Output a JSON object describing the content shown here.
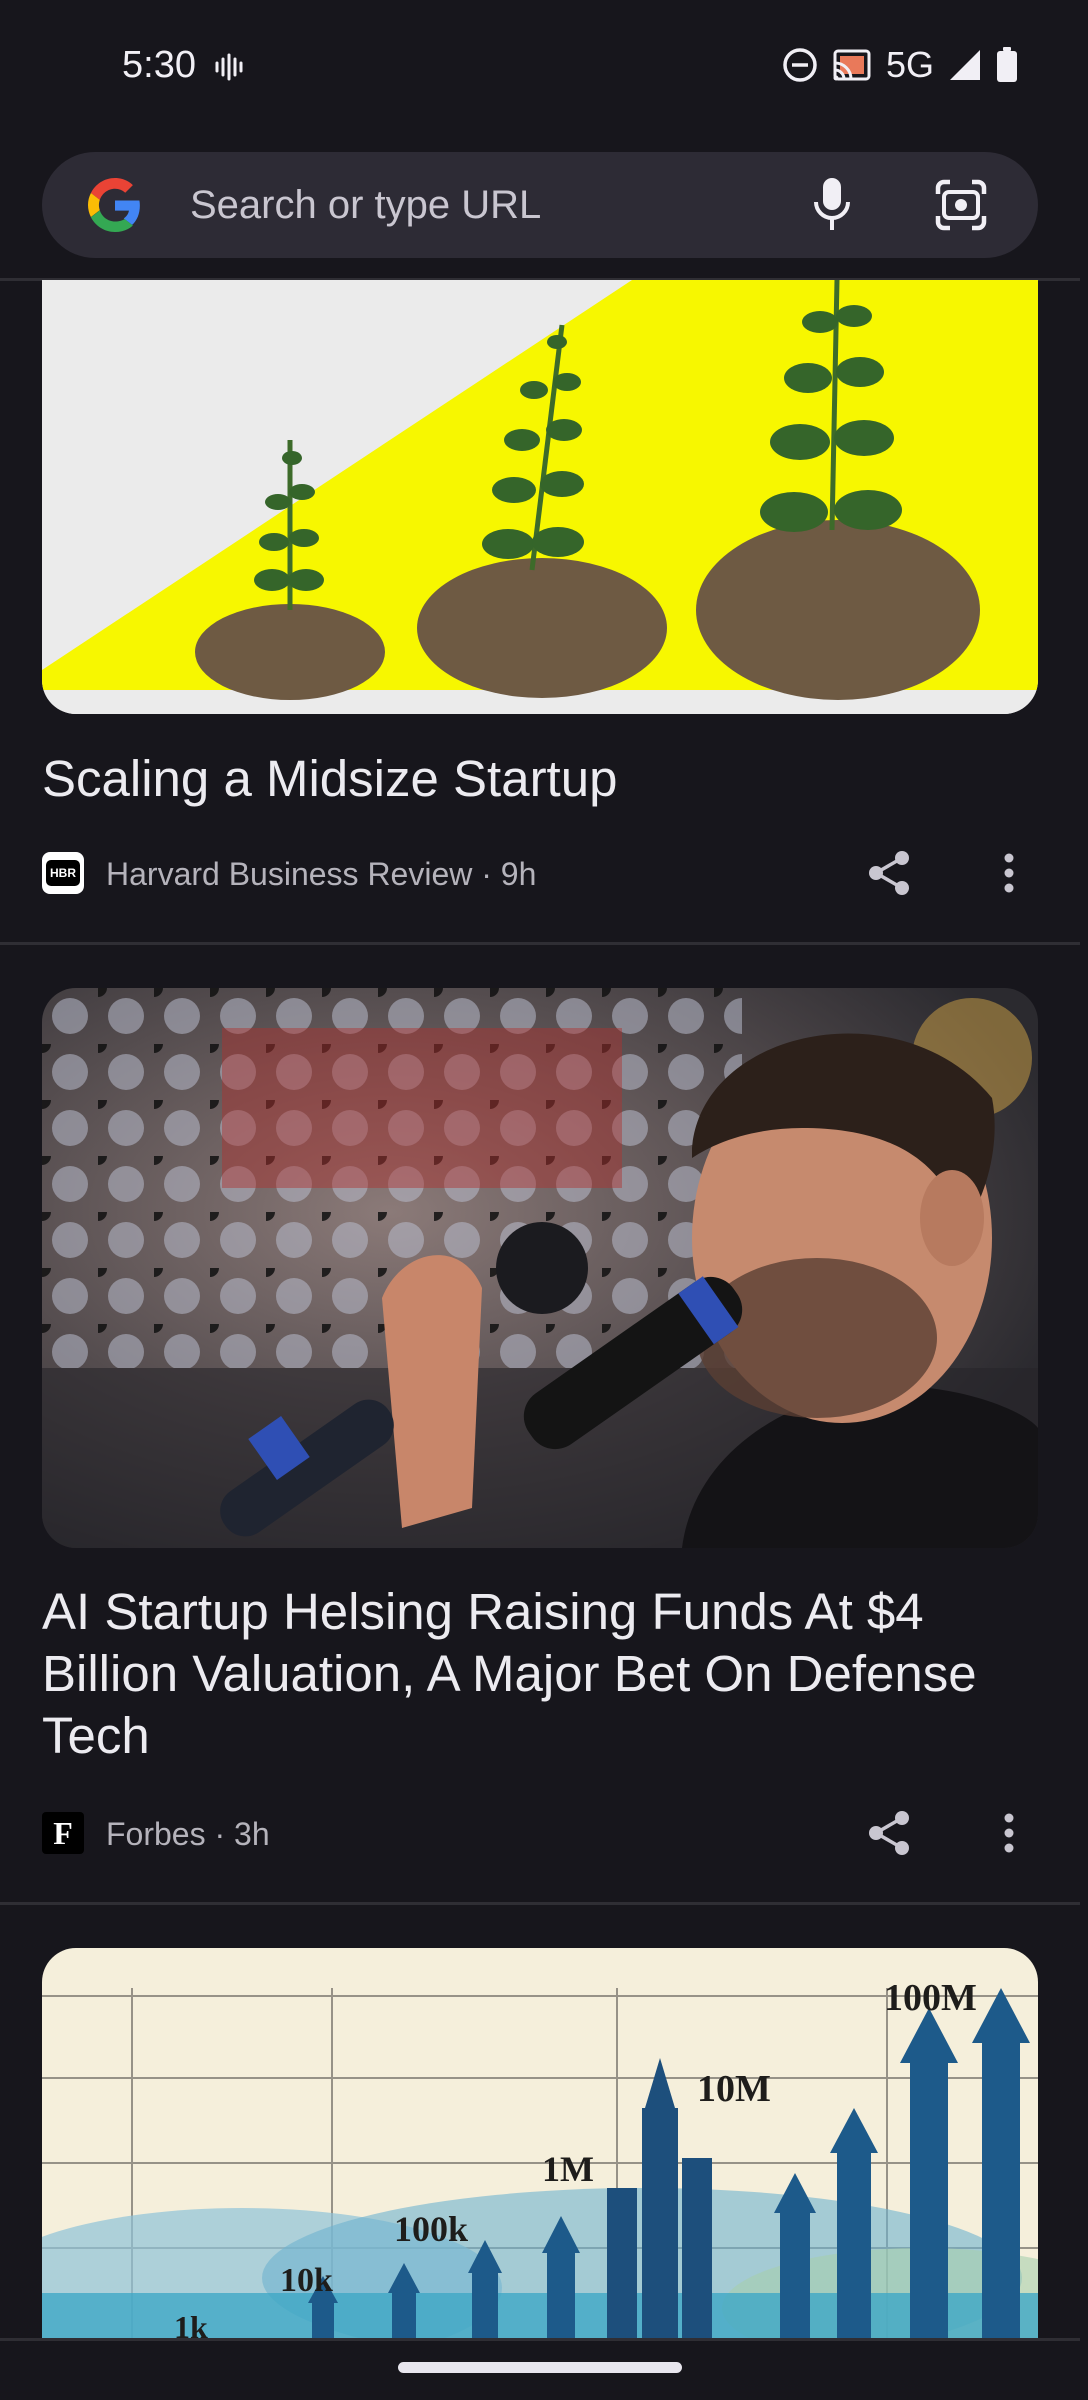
{
  "status_bar": {
    "time": "5:30",
    "network": "5G",
    "icons": [
      "vibrate-icon",
      "do-not-disturb-icon",
      "cast-icon",
      "signal-icon",
      "battery-icon"
    ]
  },
  "search": {
    "placeholder": "Search or type URL",
    "icons": [
      "google-logo",
      "mic-icon",
      "lens-icon"
    ]
  },
  "articles": [
    {
      "title": "Scaling a Midsize Startup",
      "source": "Harvard Business Review · 9h",
      "source_logo": "HBR",
      "image": "seedlings-growing-illustration"
    },
    {
      "title": "AI Startup Helsing Raising Funds At $4 Billion Valuation, A Major Bet On Defense Tech",
      "source": "Forbes · 3h",
      "source_logo": "F",
      "image": "man-speaking-into-microphone"
    },
    {
      "title": "",
      "source": "",
      "image": "growth-chart-illustration",
      "image_labels": [
        "1k",
        "10k",
        "100k",
        "1M",
        "10M",
        "100M"
      ]
    }
  ],
  "colors": {
    "background": "#17161c",
    "search_bar": "#2d2b35",
    "text_primary": "#ecebf0",
    "text_secondary": "#b5b3bb"
  }
}
